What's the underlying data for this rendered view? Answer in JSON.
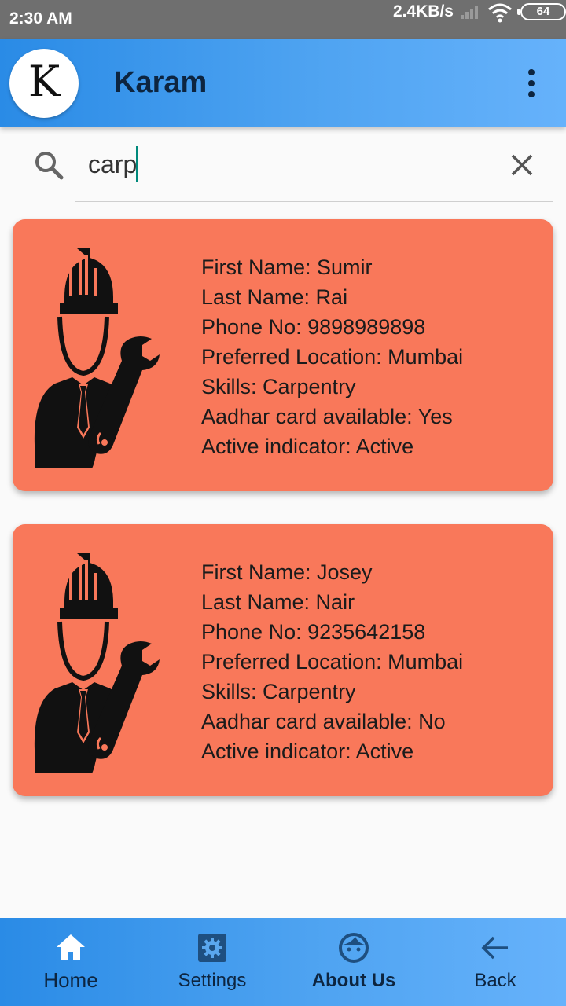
{
  "status_bar": {
    "time": "2:30 AM",
    "net_speed": "2.4KB/s",
    "battery": "64"
  },
  "app_bar": {
    "title": "Karam",
    "logo_letter": "K"
  },
  "search": {
    "value": "carp"
  },
  "results": [
    {
      "first_name": "First Name: Sumir",
      "last_name": "Last Name: Rai",
      "phone": "Phone No: 9898989898",
      "location": "Preferred Location: Mumbai",
      "skills": "Skills: Carpentry",
      "aadhar": "Aadhar card available: Yes",
      "active": "Active indicator: Active"
    },
    {
      "first_name": "First Name: Josey",
      "last_name": "Last Name: Nair",
      "phone": "Phone No: 9235642158",
      "location": "Preferred Location: Mumbai",
      "skills": "Skills: Carpentry",
      "aadhar": "Aadhar card available: No",
      "active": "Active indicator: Active"
    }
  ],
  "bottom_nav": {
    "home": "Home",
    "settings": "Settings",
    "about": "About Us",
    "back": "Back"
  },
  "colors": {
    "app_bar": "#4ea3f1",
    "card": "#f9785a",
    "text_dark": "#0d2540",
    "caret": "#00897b"
  },
  "icons": {
    "worker": "worker-with-wrench-icon",
    "search": "search-icon",
    "clear": "close-icon",
    "home": "home-icon",
    "settings": "gear-icon",
    "about": "face-icon",
    "back": "arrow-left-icon"
  }
}
